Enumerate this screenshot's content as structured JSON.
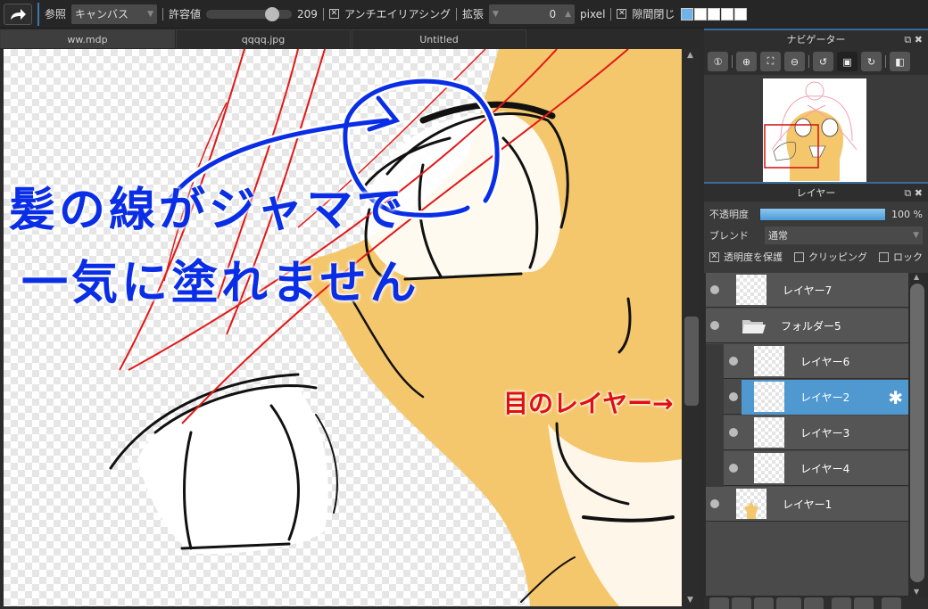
{
  "toolbar": {
    "reference_label": "参照",
    "reference_value": "キャンバス",
    "tolerance_label": "許容値",
    "tolerance_value": "209",
    "tolerance_fraction": 0.82,
    "antialias_label": "アンチエイリアシング",
    "antialias_checked": true,
    "expand_label": "拡張",
    "expand_value": "0",
    "expand_unit": "pixel",
    "gap_close_label": "隙間閉じ",
    "gap_close_checked": true,
    "gap_close_level": 1,
    "gap_close_levels": 5
  },
  "tabs": [
    {
      "label": "ww.mdp",
      "active": true
    },
    {
      "label": "qqqq.jpg",
      "active": false
    },
    {
      "label": "Untitled",
      "active": false
    }
  ],
  "annotations": {
    "line1": "髪の線がジャマで",
    "line2": "一気に塗れません",
    "layer_note": "目のレイヤー→",
    "blue": "#0a2ee6",
    "red": "#e01010"
  },
  "navigator": {
    "title": "ナビゲーター",
    "tools": [
      "zoom-actual-icon",
      "zoom-in-icon",
      "fit-icon",
      "zoom-out-icon",
      "rotate-left-icon",
      "reset-view-icon",
      "rotate-right-icon",
      "flip-icon"
    ]
  },
  "layers_panel": {
    "title": "レイヤー",
    "opacity_label": "不透明度",
    "opacity_value": "100 %",
    "opacity_fraction": 1.0,
    "blend_label": "ブレンド",
    "blend_value": "通常",
    "protect_alpha_label": "透明度を保護",
    "protect_alpha_checked": true,
    "clipping_label": "クリッピング",
    "clipping_checked": false,
    "lock_label": "ロック",
    "lock_checked": false,
    "selected_color": "#4f98d0",
    "layers": [
      {
        "name": "レイヤー7",
        "type": "layer",
        "indent": 0,
        "selected": false
      },
      {
        "name": "フォルダー5",
        "type": "folder",
        "indent": 0,
        "selected": false
      },
      {
        "name": "レイヤー6",
        "type": "layer",
        "indent": 1,
        "selected": false
      },
      {
        "name": "レイヤー2",
        "type": "layer",
        "indent": 1,
        "selected": true
      },
      {
        "name": "レイヤー3",
        "type": "layer",
        "indent": 1,
        "selected": false
      },
      {
        "name": "レイヤー4",
        "type": "layer",
        "indent": 1,
        "selected": false
      },
      {
        "name": "レイヤー1",
        "type": "layer",
        "indent": 0,
        "selected": false
      }
    ]
  }
}
